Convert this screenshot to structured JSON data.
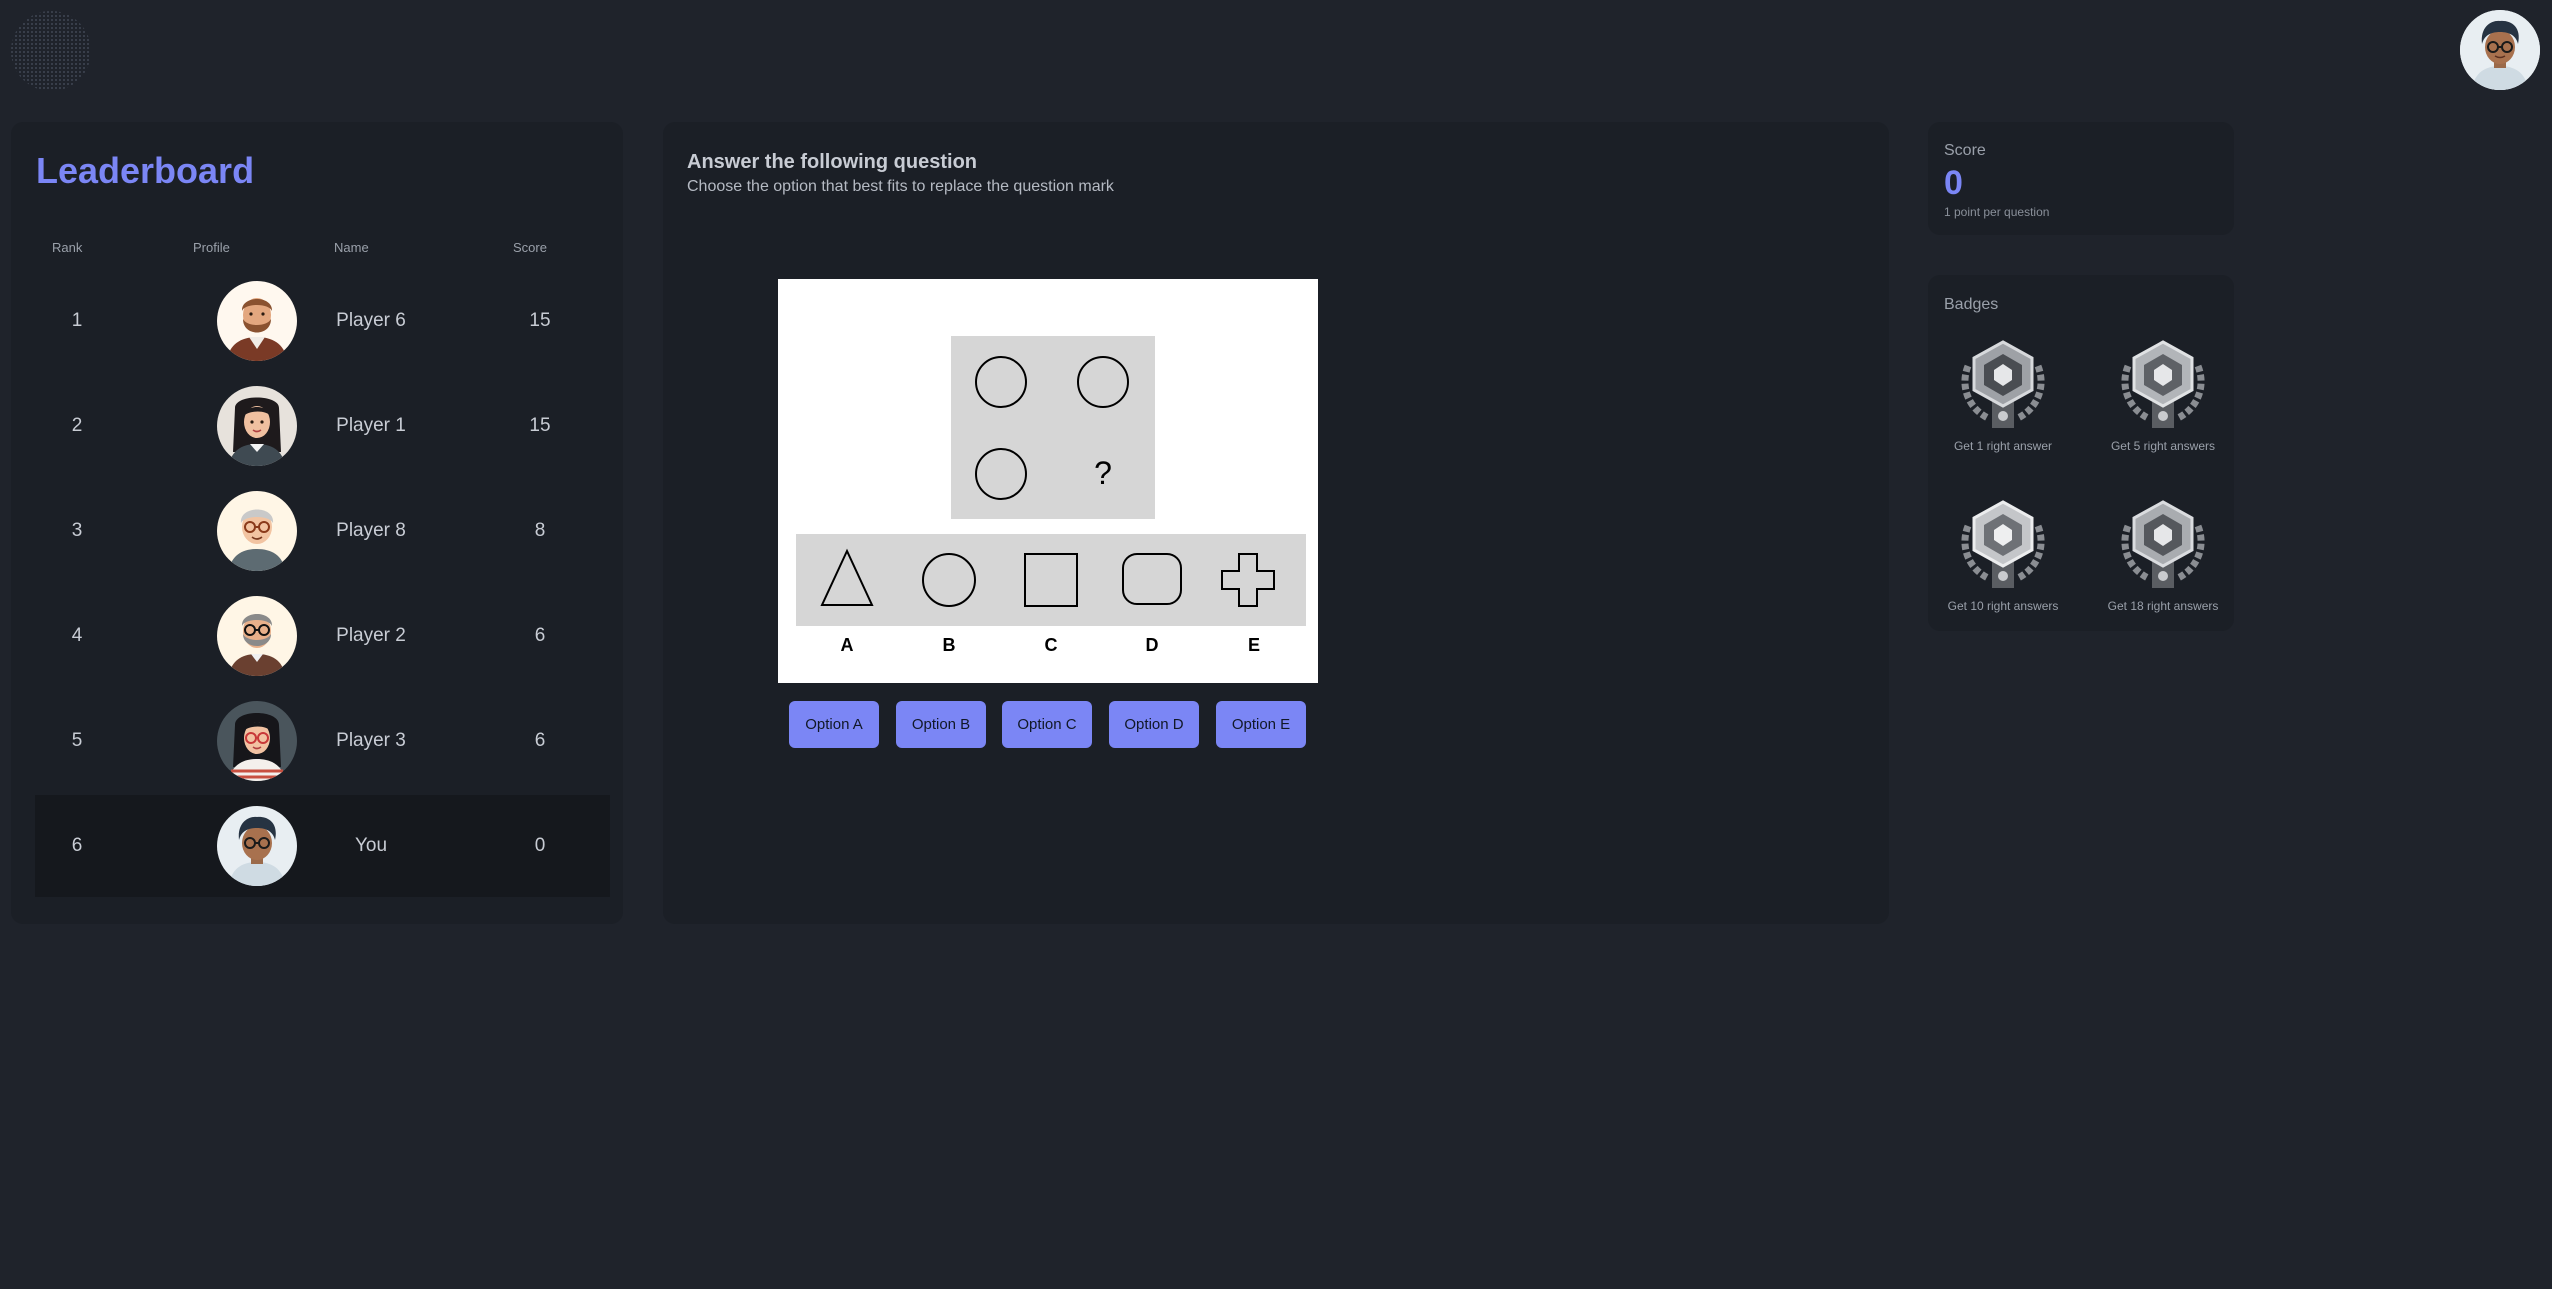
{
  "leaderboard": {
    "title": "Leaderboard",
    "headers": {
      "rank": "Rank",
      "profile": "Profile",
      "name": "Name",
      "score": "Score"
    },
    "rows": [
      {
        "rank": "1",
        "name": "Player 6",
        "score": "15"
      },
      {
        "rank": "2",
        "name": "Player 1",
        "score": "15"
      },
      {
        "rank": "3",
        "name": "Player 8",
        "score": "8"
      },
      {
        "rank": "4",
        "name": "Player 2",
        "score": "6"
      },
      {
        "rank": "5",
        "name": "Player 3",
        "score": "6"
      },
      {
        "rank": "6",
        "name": "You",
        "score": "0"
      }
    ]
  },
  "question": {
    "title": "Answer the following question",
    "subtitle": "Choose the option that best fits to replace the question mark",
    "grid_mark": "?",
    "option_letters": [
      "A",
      "B",
      "C",
      "D",
      "E"
    ],
    "buttons": [
      "Option A",
      "Option B",
      "Option C",
      "Option D",
      "Option E"
    ]
  },
  "score": {
    "label": "Score",
    "value": "0",
    "note": "1 point per question"
  },
  "badges": {
    "label": "Badges",
    "items": [
      {
        "caption": "Get 1 right answer"
      },
      {
        "caption": "Get 5 right answers"
      },
      {
        "caption": "Get 10 right answers"
      },
      {
        "caption": "Get 18 right answers"
      }
    ]
  },
  "colors": {
    "accent": "#7b86f5",
    "background": "#1f232b",
    "panel": "#1b1f26",
    "highlight_row": "#15181d"
  }
}
